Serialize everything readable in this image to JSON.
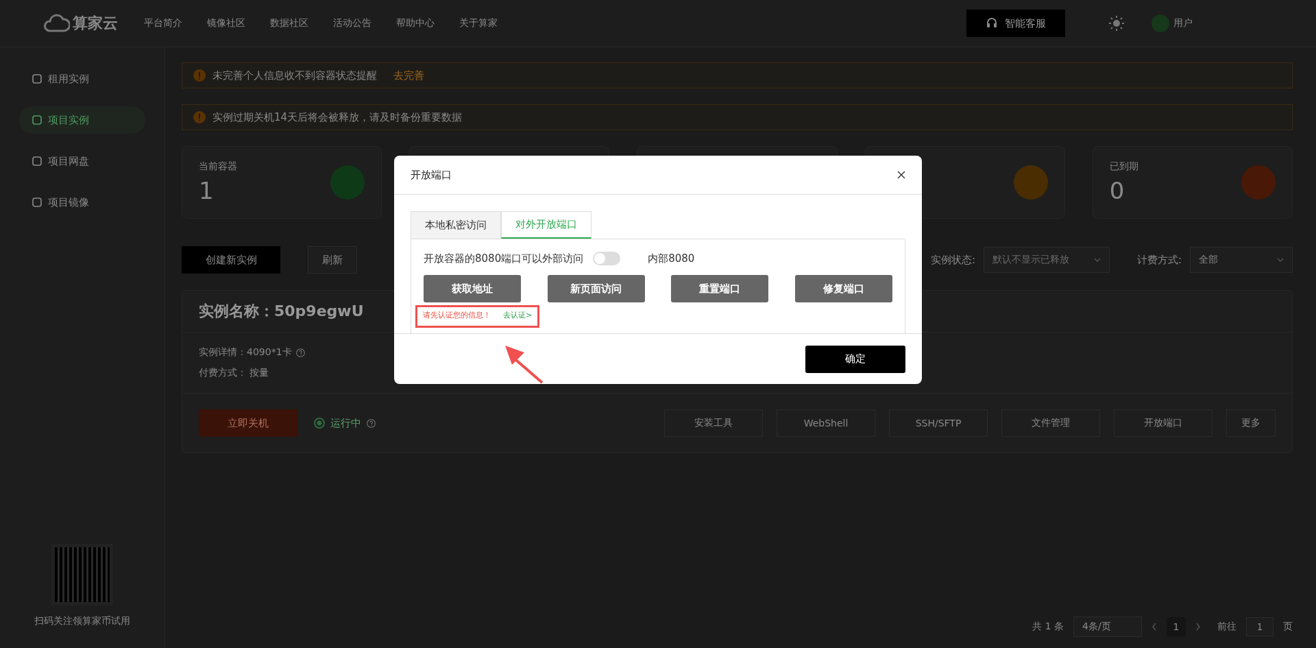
{
  "header": {
    "logo": "算家云",
    "nav": [
      "平台简介",
      "镜像社区",
      "数据社区",
      "活动公告",
      "帮助中心",
      "关于算家"
    ],
    "service_button": "智能客服",
    "user": "用户"
  },
  "sidebar": {
    "items": [
      {
        "label": "租用实例",
        "selected": false
      },
      {
        "label": "项目实例",
        "selected": true
      },
      {
        "label": "项目网盘",
        "selected": false
      },
      {
        "label": "项目镜像",
        "selected": false
      }
    ],
    "qr_caption": "扫码关注领算家币试用"
  },
  "notices": [
    {
      "text": "未完善个人信息收不到容器状态提醒",
      "link": "去完善"
    },
    {
      "text": "实例过期关机14天后将会被释放，请及时备份重要数据"
    }
  ],
  "stats": [
    {
      "kind": "stat",
      "label": "当前容器",
      "value": "1",
      "color": "#0f3a17"
    },
    {
      "kind": "covered"
    },
    {
      "kind": "covered"
    },
    {
      "kind": "stat",
      "color": "#4a2d00"
    },
    {
      "kind": "stat",
      "label": "已到期",
      "value": "0",
      "color": "#4a1806"
    }
  ],
  "toolbar": {
    "create": "创建新实例",
    "refresh": "刷新",
    "status_label": "实例状态:",
    "status_placeholder": "默认不显示已释放",
    "billing_label": "计费方式:",
    "billing_value": "全部"
  },
  "instance": {
    "name": "实例名称：50p9egwU",
    "details": "实例详情：4090*1卡",
    "billing": "付费方式： 按量",
    "shutdown": "立即关机",
    "status": "运行中",
    "running": true,
    "actions": [
      "安装工具",
      "WebShell",
      "SSH/SFTP",
      "文件管理",
      "开放端口",
      "更多"
    ]
  },
  "pagination": {
    "total": "共 1 条",
    "page_size": "4条/页",
    "page": "1",
    "goto": "前往",
    "goto_value": "1",
    "page_suffix": "页"
  },
  "dialog": {
    "title": "开放端口",
    "tabs": [
      {
        "label": "本地私密访问",
        "selected": false
      },
      {
        "label": "对外开放端口",
        "selected": true
      }
    ],
    "description": "开放容器的8080端口可以外部访问",
    "toggle_on": false,
    "internal": "内部8080",
    "buttons": [
      "获取地址",
      "新页面访问",
      "重置端口",
      "修复端口"
    ],
    "warning": "请先认证您的信息！",
    "warning_link": "去认证>",
    "confirm": "确定"
  }
}
